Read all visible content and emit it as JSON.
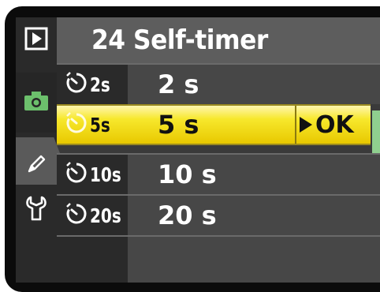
{
  "menu": {
    "title": "24 Self-timer"
  },
  "tabs": [
    {
      "name": "playback-tab",
      "icon": "play-icon"
    },
    {
      "name": "shooting-tab",
      "icon": "camera-icon"
    },
    {
      "name": "custom-settings-tab",
      "icon": "pencil-icon"
    },
    {
      "name": "setup-tab",
      "icon": "wrench-icon"
    }
  ],
  "options": [
    {
      "code": "2s",
      "value": "2  s",
      "selected": false
    },
    {
      "code": "5s",
      "value": "5  s",
      "selected": true
    },
    {
      "code": "10s",
      "value": "10  s",
      "selected": false
    },
    {
      "code": "20s",
      "value": "20  s",
      "selected": false
    }
  ],
  "ok_label": "OK",
  "colors": {
    "highlight": "#f2dc10",
    "tab_active": "#5a5a5a",
    "camera_green": "#6cc06c"
  }
}
